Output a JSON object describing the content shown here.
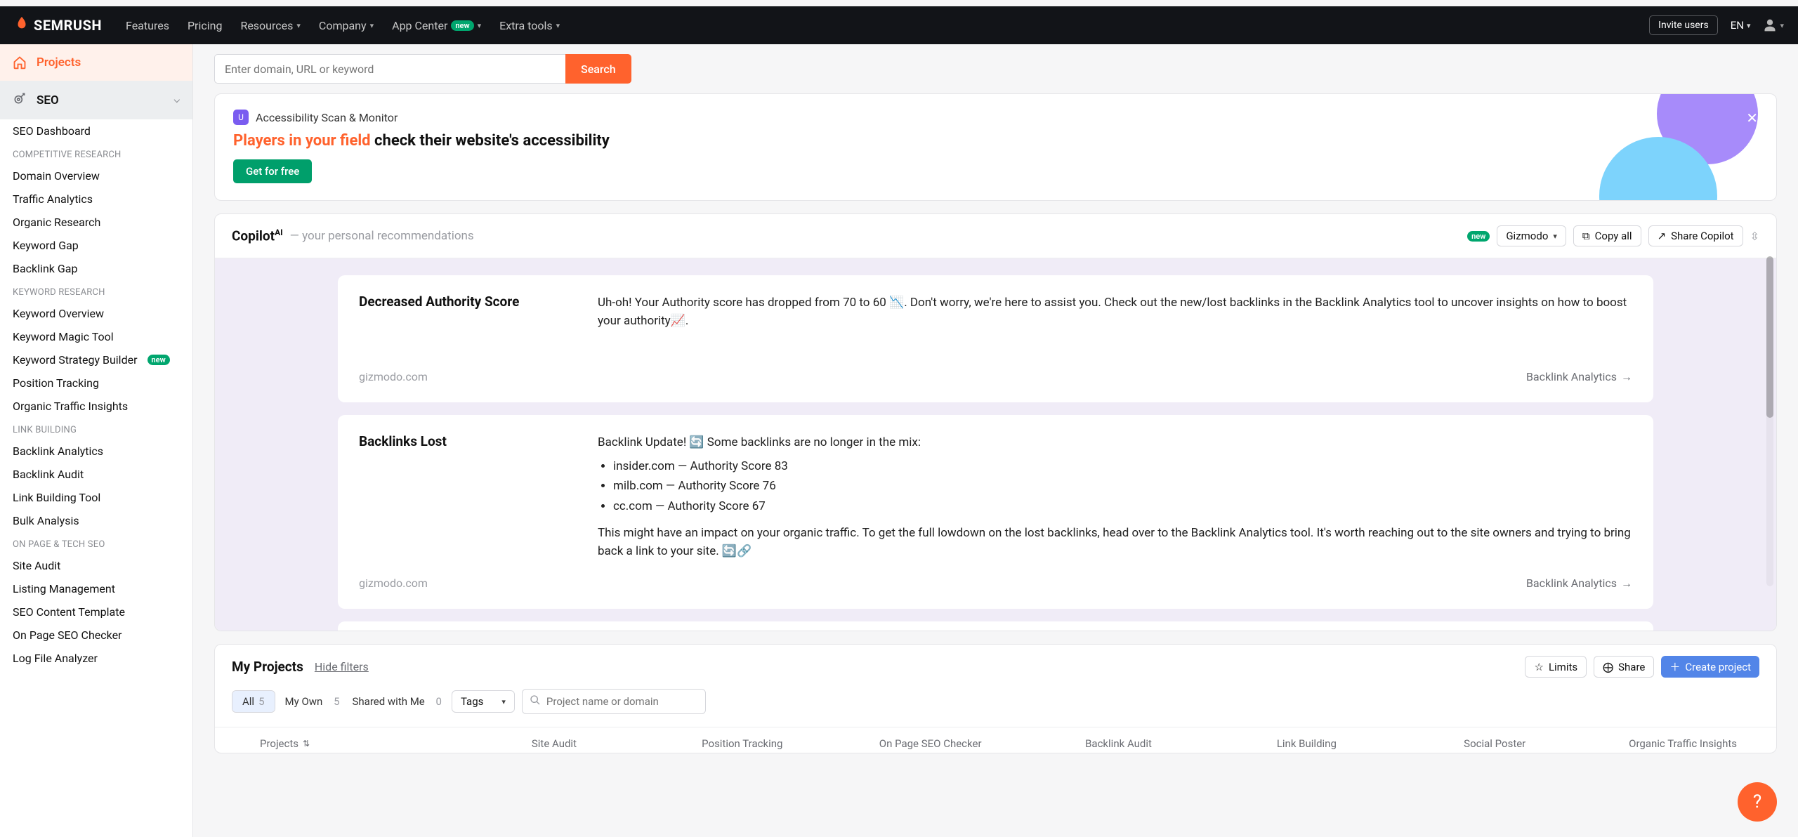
{
  "topnav": {
    "brand": "SEMRUSH",
    "items": [
      "Features",
      "Pricing",
      "Resources",
      "Company",
      "App Center",
      "Extra tools"
    ],
    "badge_new": "new",
    "invite": "Invite users",
    "lang": "EN"
  },
  "sidebar": {
    "projects": "Projects",
    "section": "SEO",
    "dashboard": "SEO Dashboard",
    "groups": [
      {
        "label": "COMPETITIVE RESEARCH",
        "items": [
          "Domain Overview",
          "Traffic Analytics",
          "Organic Research",
          "Keyword Gap",
          "Backlink Gap"
        ]
      },
      {
        "label": "KEYWORD RESEARCH",
        "items": [
          "Keyword Overview",
          "Keyword Magic Tool",
          "Keyword Strategy Builder",
          "Position Tracking",
          "Organic Traffic Insights"
        ],
        "new_index": 2
      },
      {
        "label": "LINK BUILDING",
        "items": [
          "Backlink Analytics",
          "Backlink Audit",
          "Link Building Tool",
          "Bulk Analysis"
        ]
      },
      {
        "label": "ON PAGE & TECH SEO",
        "items": [
          "Site Audit",
          "Listing Management",
          "SEO Content Template",
          "On Page SEO Checker",
          "Log File Analyzer"
        ]
      }
    ]
  },
  "search": {
    "placeholder": "Enter domain, URL or keyword",
    "button": "Search"
  },
  "promo": {
    "hdr": "Accessibility Scan & Monitor",
    "title_orange": "Players in your field",
    "title_rest": " check their website's accessibility",
    "cta": "Get for free"
  },
  "copilot": {
    "title": "Copilot",
    "sup": "AI",
    "sub": " — your personal recommendations",
    "badge": "new",
    "selector": "Gizmodo",
    "copy": "Copy all",
    "share": "Share Copilot",
    "cards": [
      {
        "title": "Decreased Authority Score",
        "body": "Uh-oh! Your Authority score has dropped from 70 to 60 📉. Don't worry, we're here to assist you. Check out the new/lost backlinks in the Backlink Analytics tool to uncover insights on how to boost your authority📈.",
        "domain": "gizmodo.com",
        "link": "Backlink Analytics"
      },
      {
        "title": "Backlinks Lost",
        "body_intro": "Backlink Update! 🔄 Some backlinks are no longer in the mix:",
        "bullets": [
          "insider.com — Authority Score 83",
          "milb.com — Authority Score 76",
          "cc.com — Authority Score 67"
        ],
        "body_outro": "This might have an impact on your organic traffic. To get the full lowdown on the lost backlinks, head over to the Backlink Analytics tool. It's worth reaching out to the site owners and trying to bring back a link to your site. 🔄🔗",
        "domain": "gizmodo.com",
        "link": "Backlink Analytics"
      }
    ]
  },
  "projects": {
    "title": "My Projects",
    "hide": "Hide filters",
    "limits": "Limits",
    "share": "Share",
    "create": "Create project",
    "tabs": [
      {
        "label": "All",
        "count": "5"
      },
      {
        "label": "My Own",
        "count": "5"
      },
      {
        "label": "Shared with Me",
        "count": "0"
      }
    ],
    "tags": "Tags",
    "search_placeholder": "Project name or domain",
    "columns": [
      "Projects",
      "Site Audit",
      "Position Tracking",
      "On Page SEO Checker",
      "Backlink Audit",
      "Link Building",
      "Social Poster",
      "Organic Traffic Insights"
    ]
  }
}
